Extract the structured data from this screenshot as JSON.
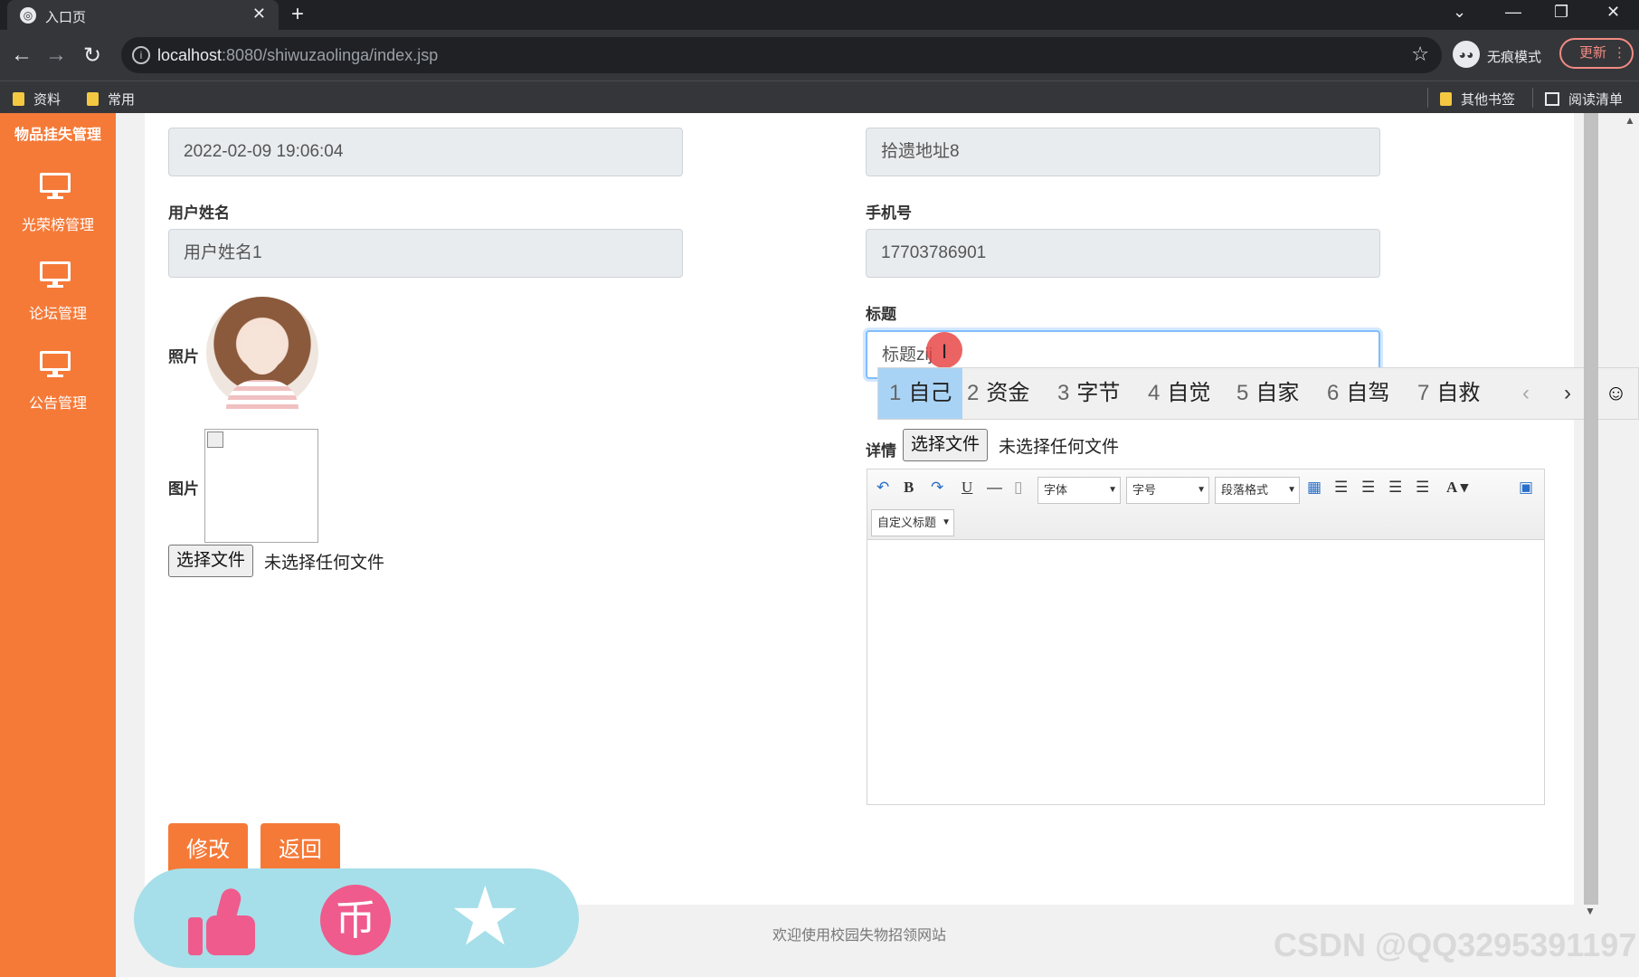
{
  "browser": {
    "tab_title": "入口页",
    "url_host": "localhost",
    "url_path": ":8080/shiwuzaolinga/index.jsp",
    "incognito_label": "无痕模式",
    "update_label": "更新",
    "bookmarks": [
      "资料",
      "常用"
    ],
    "other_bookmarks": "其他书签",
    "reading_list": "阅读清单"
  },
  "sidebar": {
    "brand": "物品挂失管理",
    "items": [
      {
        "label": "光荣榜管理"
      },
      {
        "label": "论坛管理"
      },
      {
        "label": "公告管理"
      }
    ]
  },
  "form": {
    "date_value": "2022-02-09 19:06:04",
    "pickup_value": "拾遗地址8",
    "username_label": "用户姓名",
    "username_value": "用户姓名1",
    "phone_label": "手机号",
    "phone_value": "17703786901",
    "photo_label": "照片",
    "title_label": "标题",
    "title_value": "标题zij",
    "image_label": "图片",
    "file_button": "选择文件",
    "file_none": "未选择任何文件",
    "detail_label": "详情",
    "detail_file_button": "选择文件",
    "detail_file_none": "未选择任何文件",
    "edit_button": "修改",
    "back_button": "返回"
  },
  "ime": {
    "candidates": [
      {
        "num": "1",
        "text": "自己"
      },
      {
        "num": "2",
        "text": "资金"
      },
      {
        "num": "3",
        "text": "字节"
      },
      {
        "num": "4",
        "text": "自觉"
      },
      {
        "num": "5",
        "text": "自家"
      },
      {
        "num": "6",
        "text": "自驾"
      },
      {
        "num": "7",
        "text": "自救"
      }
    ],
    "selected_index": 0
  },
  "editor": {
    "font_select": "字体",
    "size_select": "字号",
    "paragraph_select": "段落格式",
    "custom_title_select": "自定义标题"
  },
  "footer": "欢迎使用校园失物招领网站",
  "watermark": "CSDN @QQ3295391197",
  "colors": {
    "accent": "#f57a38",
    "ime_selected": "#a9d3f5",
    "reaction_bg": "#a6dfe9",
    "reaction_icon": "#ef5b8c"
  }
}
